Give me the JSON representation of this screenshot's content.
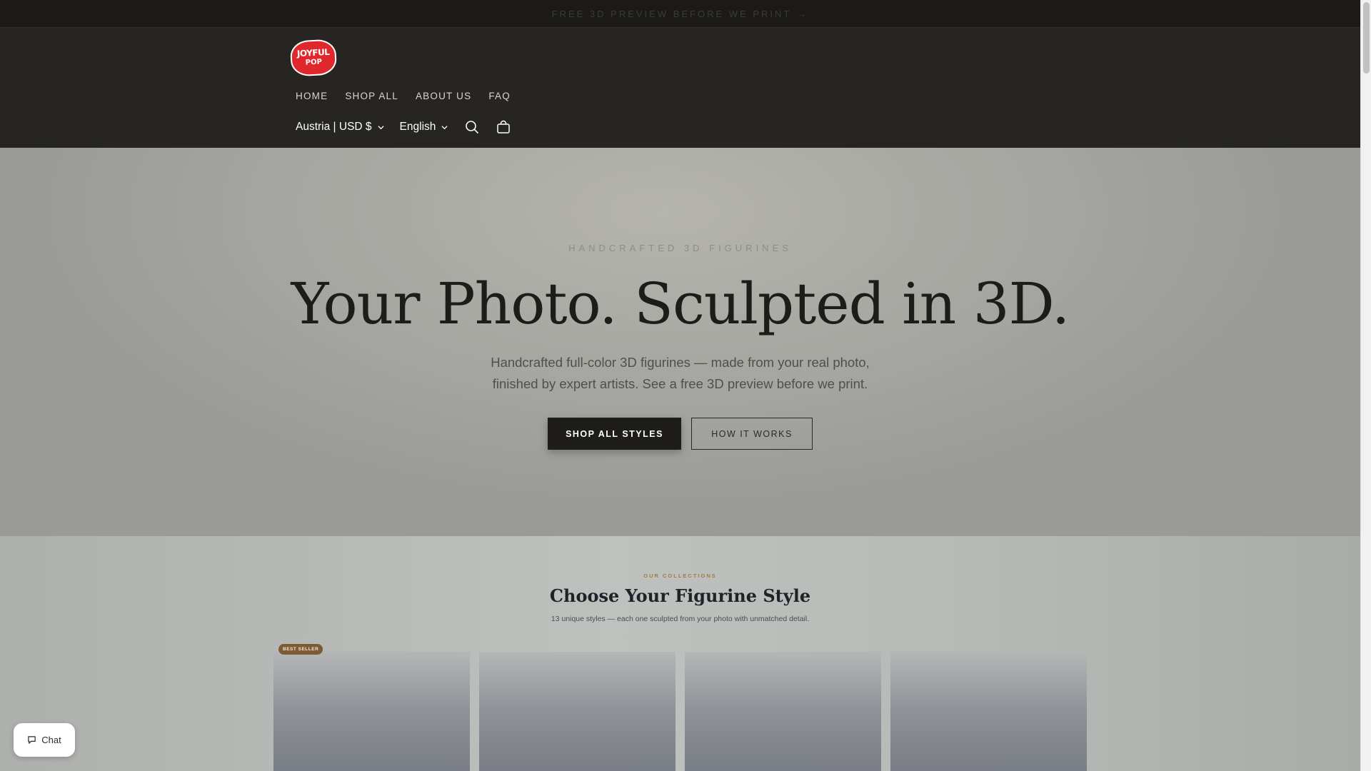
{
  "announcement": {
    "text": "FREE 3D PREVIEW BEFORE WE PRINT",
    "arrow": "→"
  },
  "logo": {
    "line1": "JOYFUL",
    "line2": "POP"
  },
  "nav": {
    "items": [
      "HOME",
      "SHOP ALL",
      "ABOUT US",
      "FAQ"
    ]
  },
  "utility": {
    "country": "Austria | USD $",
    "language": "English"
  },
  "hero": {
    "kicker": "HANDCRAFTED 3D FIGURINES",
    "title": "Your Photo. Sculpted in 3D.",
    "subtitle_line1": "Handcrafted full-color 3D figurines — made from your real photo,",
    "subtitle_line2": "finished by expert artists. See a free 3D preview before we print.",
    "primary_button": "SHOP ALL STYLES",
    "secondary_button": "HOW IT WORKS"
  },
  "collections": {
    "kicker": "OUR COLLECTIONS",
    "title": "Choose Your Figurine Style",
    "subtitle": "13 unique styles — each one sculpted from your photo with unmatched detail.",
    "badge": "BEST SELLER"
  },
  "chat": {
    "label": "Chat"
  }
}
